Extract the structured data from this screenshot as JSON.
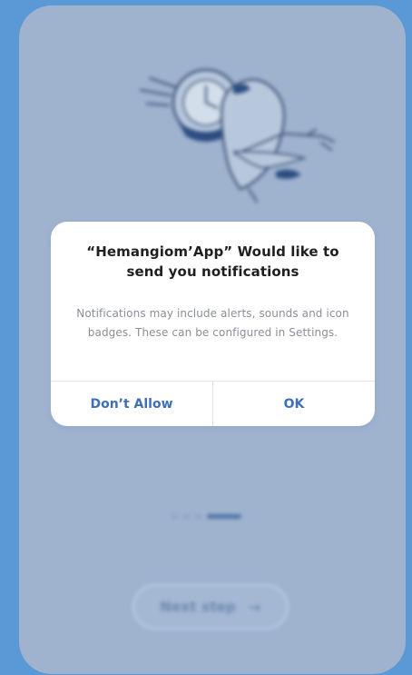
{
  "background": {
    "outer_color": "#5a98d6",
    "screen_color": "#9fb3cf"
  },
  "onboarding": {
    "next_step_label": "Next step",
    "next_step_icon": "arrow-right-icon",
    "pager_total": 4,
    "pager_active": 4
  },
  "dialog": {
    "title": "“Hemangiom’App” Would like to send you notifications",
    "message": "Notifications may include alerts, sounds and icon badges. These can be configured in Settings.",
    "dont_allow_label": "Don’t Allow",
    "ok_label": "OK",
    "accent_color": "#3f6fb8"
  }
}
